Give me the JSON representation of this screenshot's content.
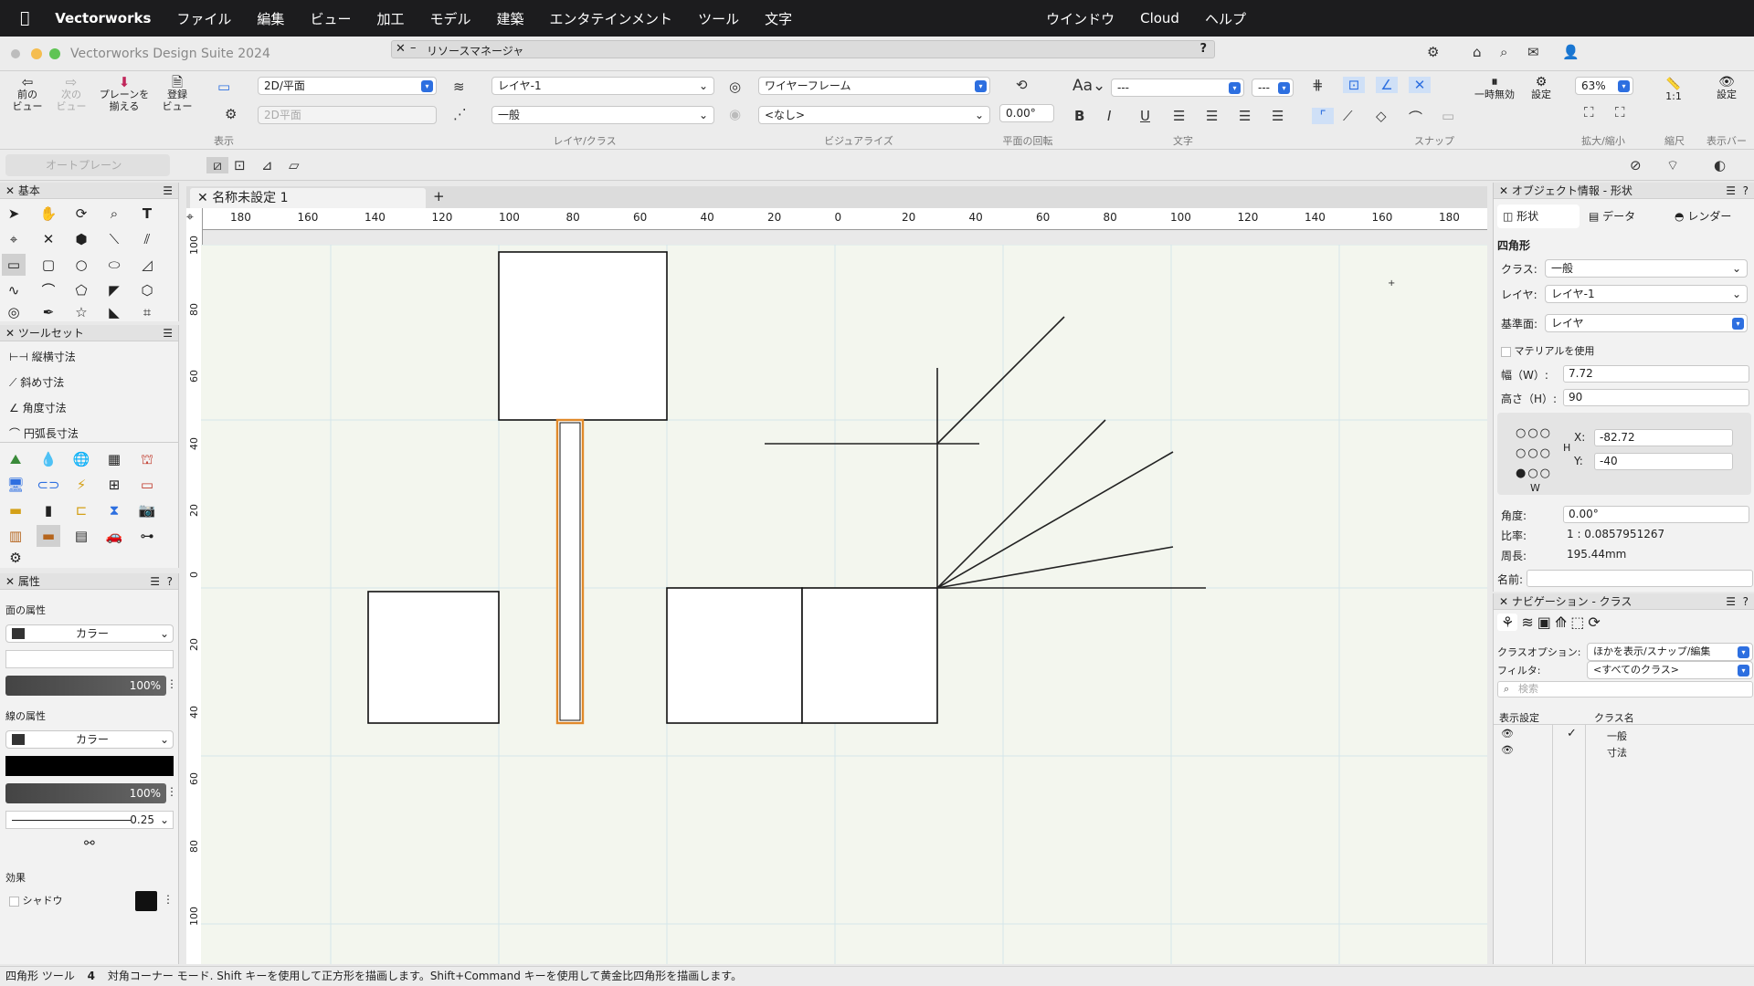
{
  "menubar": {
    "app": "Vectorworks",
    "items": [
      "ファイル",
      "編集",
      "ビュー",
      "加工",
      "モデル",
      "建築",
      "エンタテインメント",
      "ツール",
      "文字"
    ],
    "right_items": [
      "ウインドウ",
      "Cloud",
      "ヘルプ"
    ]
  },
  "window": {
    "title": "Vectorworks Design Suite 2024",
    "resource_manager": "リソースマネージャ",
    "help": "?"
  },
  "toolbar": {
    "prev_view": "前の\nビュー",
    "next_view": "次の\nビュー",
    "plane_align": "プレーンを\n揃える",
    "saved_view": "登録\nビュー",
    "view_dropdown": "2D/平面",
    "view_dropdown2": "2D平面",
    "group_view": "表示",
    "layer_dropdown": "レイヤ-1",
    "class_dropdown": "一般",
    "group_layer": "レイヤ/クラス",
    "render_dropdown": "ワイヤーフレーム",
    "none_dropdown": "<なし>",
    "group_visualize": "ビジュアライズ",
    "rotation": "0.00°",
    "group_rotation": "平面の回転",
    "font_size": "---",
    "font_style": "---",
    "group_text": "文字",
    "group_snap": "スナップ",
    "pause": "一時無効",
    "settings": "設定",
    "zoom": "63%",
    "group_zoom": "拡大/縮小",
    "scale": "1:1",
    "group_scale": "縮尺",
    "settings2": "設定",
    "group_display_bar": "表示バー",
    "auto_plane": "オートプレーン"
  },
  "left": {
    "basic_title": "基本",
    "toolset_title": "ツールセット",
    "toolset_items": [
      "縦横寸法",
      "斜め寸法",
      "角度寸法",
      "円弧長寸法"
    ],
    "attr_title": "属性",
    "fill_label": "面の属性",
    "fill_type": "カラー",
    "fill_opacity": "100%",
    "line_label": "線の属性",
    "line_type": "カラー",
    "line_opacity": "100%",
    "line_weight": "0.25",
    "effects_label": "効果",
    "shadow_label": "シャドウ"
  },
  "document": {
    "tab": "名称未設定 1",
    "add": "+",
    "ruler_top": [
      "180",
      "160",
      "140",
      "120",
      "100",
      "80",
      "60",
      "40",
      "20",
      "0",
      "20",
      "40",
      "60",
      "80",
      "100",
      "120",
      "140",
      "160",
      "180"
    ],
    "ruler_left": [
      "100",
      "80",
      "60",
      "40",
      "20",
      "0",
      "20",
      "40",
      "60",
      "80",
      "100"
    ]
  },
  "objinfo": {
    "title": "オブジェクト情報 - 形状",
    "tabs": [
      "形状",
      "データ",
      "レンダー"
    ],
    "object_type": "四角形",
    "class_label": "クラス:",
    "class_value": "一般",
    "layer_label": "レイヤ:",
    "layer_value": "レイヤ-1",
    "plane_label": "基準面:",
    "plane_value": "レイヤ",
    "use_material": "マテリアルを使用",
    "width_label": "幅（W）:",
    "width_value": "7.72",
    "height_label": "高さ（H）:",
    "height_value": "90",
    "x_label": "X:",
    "x_value": "-82.72",
    "y_label": "Y:",
    "y_value": "-40",
    "h_mark": "H",
    "w_mark": "W",
    "angle_label": "角度:",
    "angle_value": "0.00°",
    "ratio_label": "比率:",
    "ratio_value": "1 : 0.0857951267",
    "perimeter_label": "周長:",
    "perimeter_value": "195.44mm",
    "name_label": "名前:"
  },
  "nav": {
    "title": "ナビゲーション - クラス",
    "class_option_label": "クラスオプション:",
    "class_option_value": "ほかを表示/スナップ/編集",
    "filter_label": "フィルタ:",
    "filter_value": "<すべてのクラス>",
    "search_placeholder": "検索",
    "col_visibility": "表示設定",
    "col_class_name": "クラス名",
    "classes": [
      "一般",
      "寸法"
    ]
  },
  "status": {
    "tool": "四角形 ツール",
    "mode_num": "4",
    "message": "対角コーナー モード. Shift キーを使用して正方形を描画します。Shift+Command キーを使用して黄金比四角形を描画します。"
  }
}
